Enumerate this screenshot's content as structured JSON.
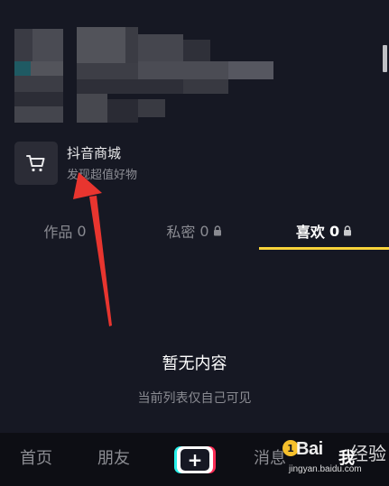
{
  "shop": {
    "title": "抖音商城",
    "subtitle": "发现超值好物",
    "icon": "cart-icon"
  },
  "tabs": [
    {
      "label": "作品",
      "count": "0",
      "locked": false,
      "active": false
    },
    {
      "label": "私密",
      "count": "0",
      "locked": true,
      "active": false
    },
    {
      "label": "喜欢",
      "count": "0",
      "locked": true,
      "active": true
    }
  ],
  "empty_state": {
    "title": "暂无内容",
    "subtitle": "当前列表仅自己可见"
  },
  "bottom_nav": {
    "home": "首页",
    "friends": "朋友",
    "messages": "消息",
    "messages_badge": "1",
    "me": "我"
  },
  "watermark": {
    "logo": "Bai",
    "logo_suffix": "经验",
    "url": "jingyan.baidu.com"
  },
  "colors": {
    "background": "#161823",
    "active_underline": "#f8d33a",
    "annotation_arrow": "#e8352f",
    "badge": "#f6c02c"
  }
}
